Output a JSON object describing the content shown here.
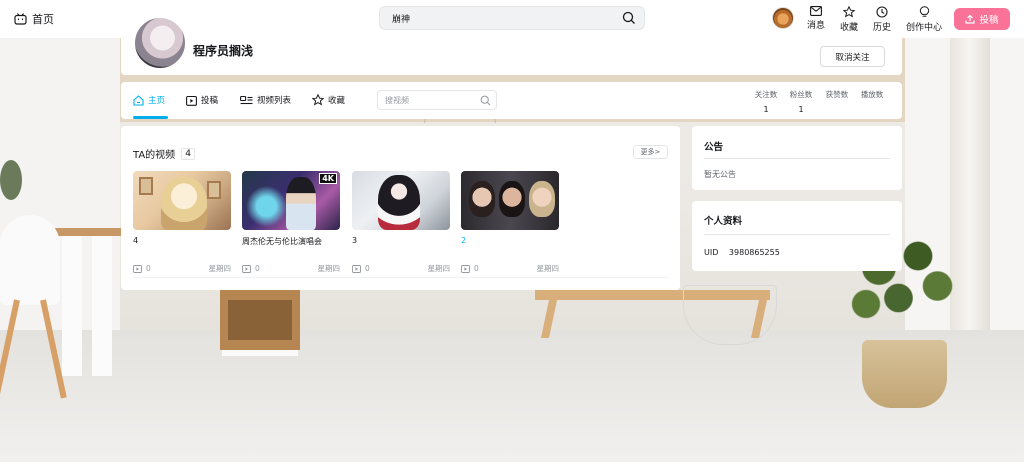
{
  "header": {
    "home_label": "首页",
    "search_value": "崩神",
    "nav": [
      {
        "label": "消息",
        "icon": "mail-icon"
      },
      {
        "label": "收藏",
        "icon": "star-icon"
      },
      {
        "label": "历史",
        "icon": "clock-icon"
      },
      {
        "label": "创作中心",
        "icon": "bulb-icon"
      }
    ],
    "upload_label": "投稿",
    "accent": "#fb7299"
  },
  "profile": {
    "name": "程序员搁浅",
    "unfollow_label": "取消关注"
  },
  "tabs": {
    "items": [
      {
        "label": "主页",
        "icon": "home-icon",
        "active": true
      },
      {
        "label": "投稿",
        "icon": "play-box-icon",
        "active": false
      },
      {
        "label": "视频列表",
        "icon": "list-icon",
        "active": false
      },
      {
        "label": "收藏",
        "icon": "star-icon",
        "active": false
      }
    ],
    "search_placeholder": "搜视频",
    "active_color": "#00aeec"
  },
  "stats": [
    {
      "label": "关注数",
      "value": "1"
    },
    {
      "label": "粉丝数",
      "value": "1"
    },
    {
      "label": "获赞数",
      "value": ""
    },
    {
      "label": "播放数",
      "value": ""
    }
  ],
  "videos": {
    "title": "TA的视频",
    "count": "4",
    "more_label": "更多>",
    "items": [
      {
        "title": "4",
        "views": "0",
        "date": "星期四"
      },
      {
        "title": "周杰伦无与伦比演唱会",
        "views": "0",
        "date": "星期四",
        "badge": "4K"
      },
      {
        "title": "3",
        "views": "0",
        "date": "星期四"
      },
      {
        "title": "2",
        "views": "0",
        "date": "星期四"
      }
    ]
  },
  "sidebar": {
    "notice_title": "公告",
    "notice_text": "暂无公告",
    "profile_title": "个人资料",
    "uid_label": "UID",
    "uid_value": "3980865255"
  }
}
